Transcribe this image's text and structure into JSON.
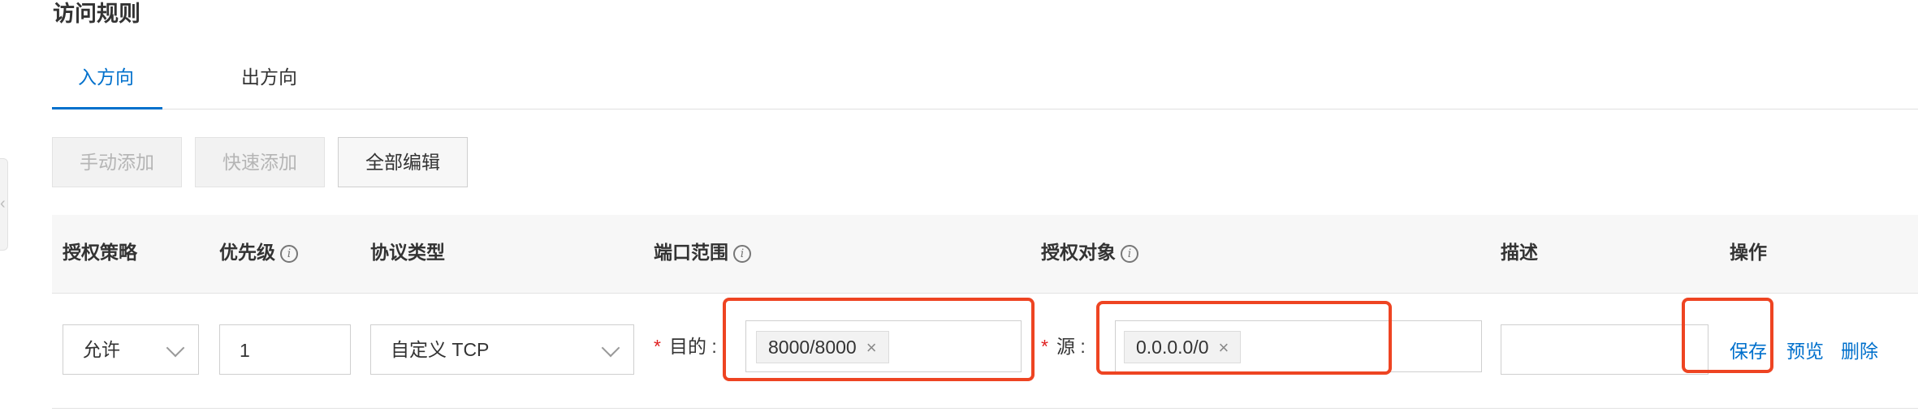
{
  "section_title": "访问规则",
  "tabs": [
    {
      "label": "入方向",
      "active": true
    },
    {
      "label": "出方向",
      "active": false
    }
  ],
  "toolbar": {
    "manual_add": "手动添加",
    "quick_add": "快速添加",
    "edit_all": "全部编辑"
  },
  "table": {
    "headers": {
      "policy": "授权策略",
      "priority": "优先级",
      "protocol": "协议类型",
      "port_range": "端口范围",
      "auth_object": "授权对象",
      "description": "描述",
      "actions": "操作"
    },
    "row": {
      "policy": "允许",
      "priority": "1",
      "protocol": "自定义 TCP",
      "port_label": "目的 :",
      "port_tag": "8000/8000",
      "source_label": "源 :",
      "source_tag": "0.0.0.0/0",
      "description": "",
      "actions": {
        "save": "保存",
        "preview": "预览",
        "delete": "删除"
      }
    }
  },
  "glyphs": {
    "required": "*",
    "tag_close": "×",
    "info": "i",
    "side_arrow": "‹"
  },
  "colors": {
    "accent": "#0070cc",
    "highlight": "#ee4422",
    "required": "#e02020"
  }
}
